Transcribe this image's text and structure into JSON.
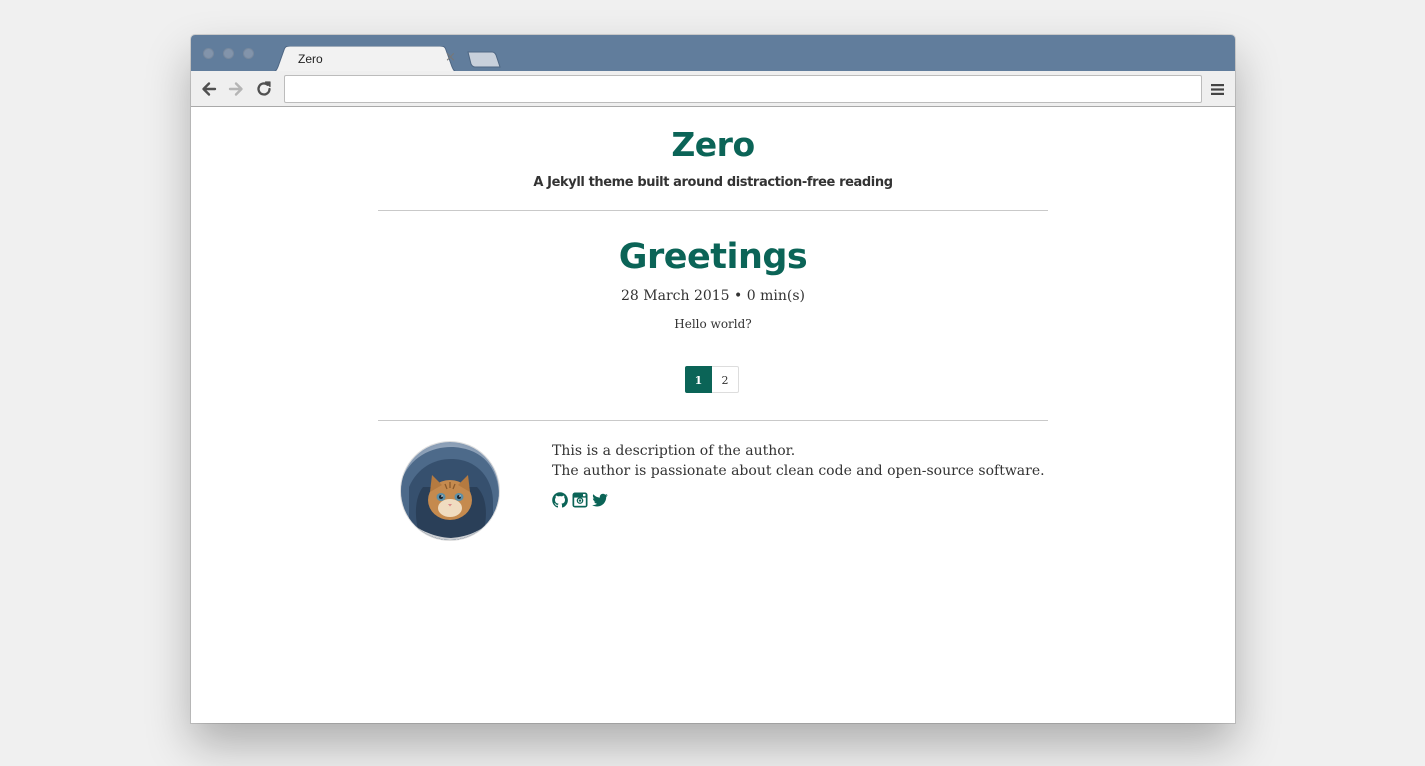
{
  "browser": {
    "tab_title": "Zero",
    "tab_close": "×",
    "url": ""
  },
  "site": {
    "title": "Zero",
    "description": "A Jekyll theme built around distraction-free reading"
  },
  "post": {
    "title": "Greetings",
    "meta": "28 March 2015 • 0 min(s)",
    "excerpt": "Hello world?"
  },
  "pagination": {
    "pages": [
      "1",
      "2"
    ],
    "current": "1"
  },
  "author": {
    "line1": "This is a description of the author.",
    "line2": "The author is passionate about clean code and open-source software.",
    "social_icons": [
      "github-icon",
      "instagram-icon",
      "twitter-icon"
    ]
  },
  "colors": {
    "accent": "#0b6457",
    "titlebar": "#617d9c",
    "background": "#f0f0f0"
  }
}
